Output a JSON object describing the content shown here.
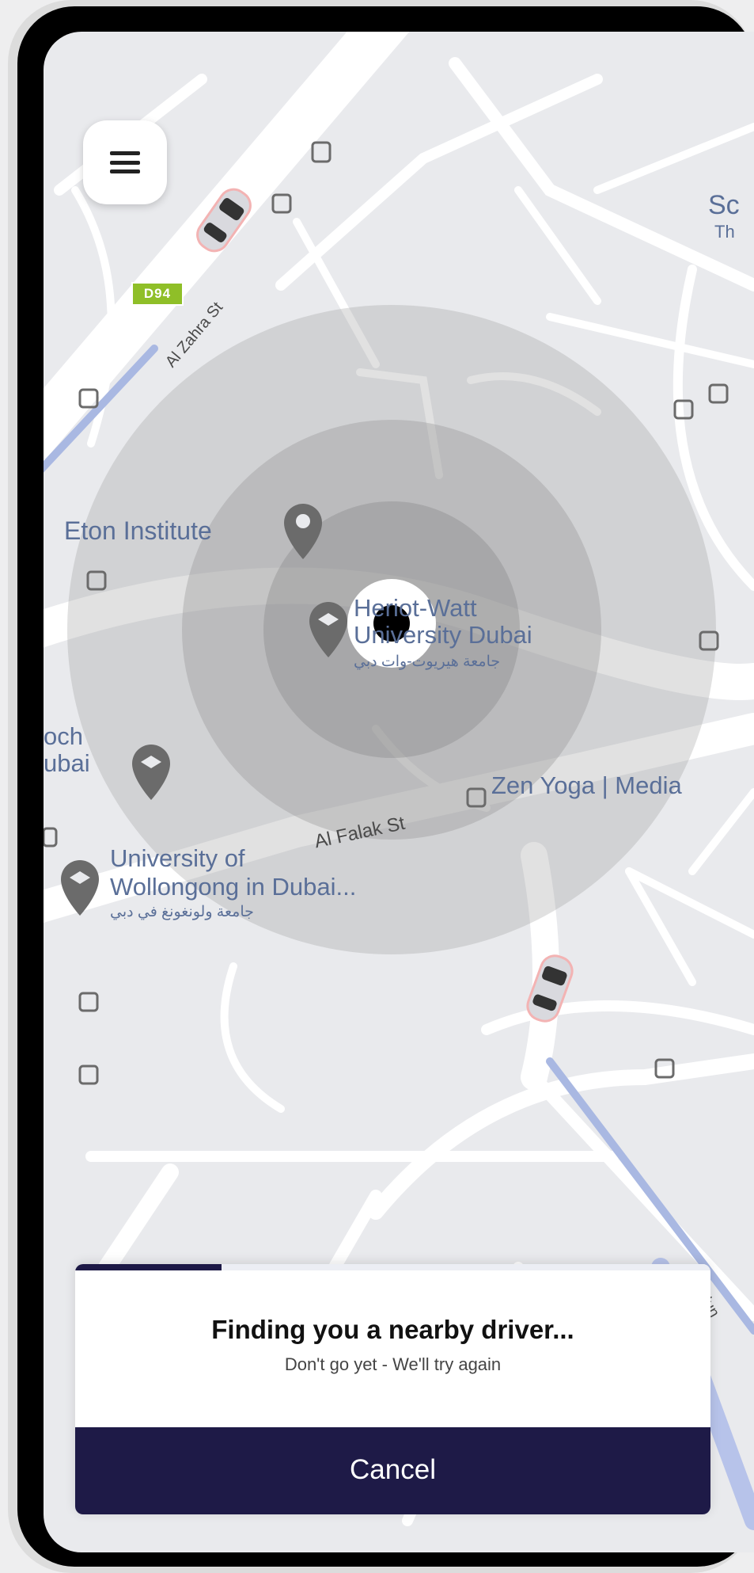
{
  "map": {
    "labels": {
      "road_tag": "D94",
      "al_zahra": "Al Zahra St",
      "eton": "Eton Institute",
      "heriot_line1": "Heriot-Watt",
      "heriot_line2": "University Dubai",
      "heriot_arabic": "جامعة هيريوت-وات دبي",
      "al_falak": "Al Falak St",
      "zen_yoga": "Zen Yoga | Media",
      "uow_line1": "University of",
      "uow_line2": "Wollongong in Dubai...",
      "uow_arabic": "جامعة ولونغونغ في دبي",
      "left_edge_line1": "och",
      "left_edge_line2": "ubai",
      "right_edge_line1": "Sc",
      "right_edge_line2": "Th",
      "bottom_right": "Sdun"
    },
    "icons": [
      "bus-stop-icon",
      "graduation-cap-pin-icon",
      "location-pin-icon",
      "car-icon"
    ]
  },
  "menu": {
    "icon": "hamburger-menu-icon"
  },
  "sheet": {
    "title": "Finding you a nearby driver...",
    "subtitle": "Don't go yet - We'll try again",
    "progress": 0.23,
    "cancel_label": "Cancel"
  },
  "colors": {
    "primary": "#1e1a47",
    "map_background": "#e9eaed",
    "road": "#ffffff",
    "label": "#5a6f98"
  }
}
